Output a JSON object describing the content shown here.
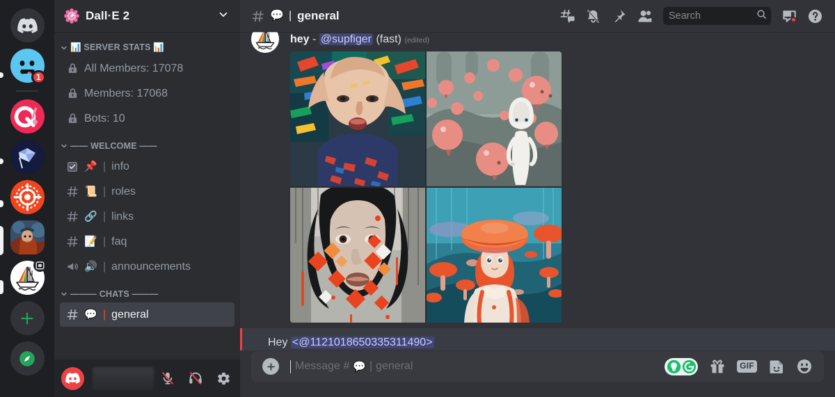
{
  "colors": {
    "rail_bg": "#1e1f22",
    "sidebar_bg": "#2b2d31",
    "main_bg": "#313338",
    "userpanel_bg": "#232428",
    "composer_bg": "#383a40",
    "active_channel_bg": "#404249",
    "accent_red": "#f23f43",
    "mention_bg": "#414675",
    "mention_text": "#c9cdfb",
    "text_muted": "#949ba4",
    "text_bright": "#f2f3f5",
    "grammarly_green": "#15c26b"
  },
  "rail": {
    "items": [
      {
        "name": "home-button",
        "icon": "discord-logo",
        "badge": null
      },
      {
        "name": "server-blue-face",
        "icon": "blue-smiley",
        "badge": "1"
      },
      {
        "name": "server-quizlet",
        "icon": "pink-q",
        "badge": null
      },
      {
        "name": "server-gem",
        "icon": "blue-gem",
        "badge": null
      },
      {
        "name": "server-orange-target",
        "icon": "orange-target",
        "badge": null
      },
      {
        "name": "server-pirate",
        "icon": "pirate-portrait",
        "badge": null
      },
      {
        "name": "server-dalle",
        "icon": "rainbow-sailboat",
        "badge": null,
        "selected": true
      },
      {
        "name": "add-server-button",
        "icon": "plus",
        "badge": null
      },
      {
        "name": "explore-servers-button",
        "icon": "compass",
        "badge": null
      }
    ]
  },
  "sidebar": {
    "server_name": "Dall·E 2",
    "server_emoji": "pink-flower",
    "categories": [
      {
        "label": "📊 SERVER STATS 📊",
        "raw_label": "SERVER STATS",
        "emoji_left": "📊",
        "emoji_right": "📊",
        "channels": [
          {
            "icon": "lock-icon",
            "emoji": "",
            "name": "All Members: 17078",
            "active": false,
            "show_bar": false
          },
          {
            "icon": "lock-icon",
            "emoji": "",
            "name": "Members: 17068",
            "active": false,
            "show_bar": false
          },
          {
            "icon": "lock-icon",
            "emoji": "",
            "name": "Bots: 10",
            "active": false,
            "show_bar": false
          }
        ]
      },
      {
        "label": "—— WELCOME ——",
        "raw_label": "WELCOME",
        "channels": [
          {
            "icon": "rules-channel-icon",
            "emoji": "📌",
            "name": "info",
            "active": false,
            "show_bar": true
          },
          {
            "icon": "hash-icon",
            "emoji": "📜",
            "name": "roles",
            "active": false,
            "show_bar": true
          },
          {
            "icon": "hash-icon",
            "emoji": "🔗",
            "name": "links",
            "active": false,
            "show_bar": true
          },
          {
            "icon": "hash-icon",
            "emoji": "📝",
            "name": "faq",
            "active": false,
            "show_bar": true
          },
          {
            "icon": "announcement-icon",
            "emoji": "🔊",
            "name": "announcements",
            "active": false,
            "show_bar": true
          }
        ]
      },
      {
        "label": "——— CHATS ———",
        "raw_label": "CHATS",
        "channels": [
          {
            "icon": "hash-icon",
            "emoji": "💬",
            "name": "general",
            "active": true,
            "show_bar": true
          }
        ]
      }
    ],
    "user_panel": {
      "username": "",
      "username_hidden": true,
      "buttons": [
        {
          "name": "mute-microphone-button",
          "icon": "mic-muted-icon",
          "muted": true
        },
        {
          "name": "deafen-button",
          "icon": "headphones-muted-icon",
          "muted": true
        },
        {
          "name": "user-settings-button",
          "icon": "gear-icon",
          "muted": false
        }
      ]
    }
  },
  "topbar": {
    "channel_icon": "hash-icon",
    "channel_emoji": "💬",
    "channel_name": "general",
    "icons": [
      {
        "name": "threads-button",
        "icon": "threads-icon"
      },
      {
        "name": "notification-settings-button",
        "icon": "bell-muted-icon"
      },
      {
        "name": "pinned-messages-button",
        "icon": "pin-icon"
      },
      {
        "name": "member-list-button",
        "icon": "members-icon"
      }
    ],
    "search": {
      "placeholder": "Search",
      "value": "",
      "icon": "search-icon"
    },
    "inbox": {
      "name": "inbox-button",
      "icon": "inbox-icon",
      "has_notification": true
    },
    "help": {
      "name": "help-button",
      "icon": "help-icon"
    }
  },
  "messages": [
    {
      "id": "msg-hey",
      "avatar": "rainbow-sailboat-avatar",
      "text_before": "hey",
      "separator": "-",
      "mention": "@supfiger",
      "text_after": "(fast)",
      "edited_label": "(edited)",
      "attachment": {
        "type": "image-grid",
        "columns": 2,
        "rows": 2,
        "images": [
          {
            "name": "ai-image-colorful-portrait",
            "alt": "woman with colorful swirling hair"
          },
          {
            "name": "ai-image-white-figure-mushrooms",
            "alt": "pale figure among pink orbs"
          },
          {
            "name": "ai-image-glitch-portrait",
            "alt": "dark haired woman with red glitch squares"
          },
          {
            "name": "ai-image-mushroom-hat-girl",
            "alt": "girl under orange mushroom cap"
          }
        ]
      }
    },
    {
      "id": "msg-highlighted",
      "highlighted": true,
      "text_before": "Hey",
      "mention": "<@1121018650335311490>"
    }
  ],
  "composer": {
    "add_button": "plus-icon",
    "placeholder_prefix": "Message #",
    "placeholder_emoji": "💬",
    "placeholder_separator": "|",
    "placeholder_channel": "general",
    "value": "",
    "buttons": [
      {
        "name": "grammarly-button",
        "icon": "grammarly-icon",
        "label": ""
      },
      {
        "name": "gift-button",
        "icon": "gift-icon",
        "label": ""
      },
      {
        "name": "gif-picker-button",
        "icon": "gif-icon",
        "label": "GIF"
      },
      {
        "name": "sticker-picker-button",
        "icon": "sticker-icon",
        "label": ""
      },
      {
        "name": "emoji-picker-button",
        "icon": "emoji-icon",
        "label": "😃"
      }
    ]
  }
}
